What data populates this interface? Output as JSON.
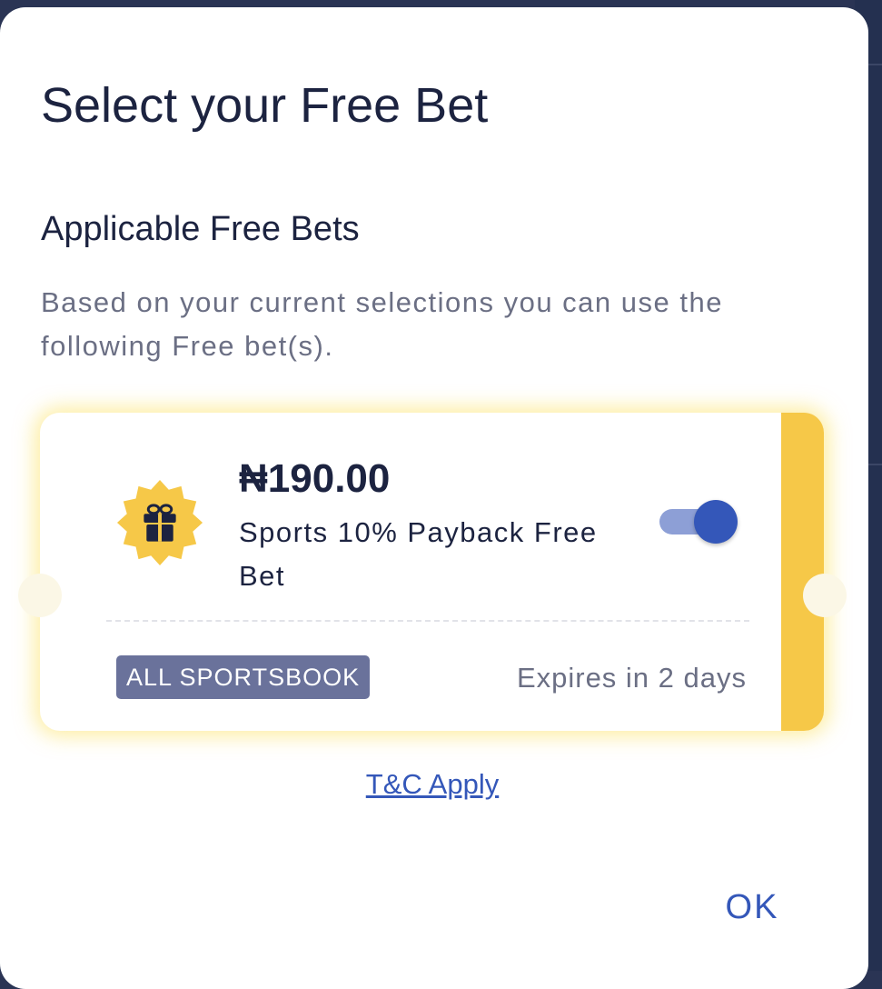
{
  "dialog": {
    "title": "Select your Free Bet",
    "section_title": "Applicable Free Bets",
    "description": "Based on your current selections you can use the following Free bet(s).",
    "ok_label": "OK",
    "tc_label": "T&C Apply"
  },
  "free_bets": [
    {
      "amount": "₦190.00",
      "name": "Sports 10% Payback Free Bet",
      "tag": "ALL SPORTSBOOK",
      "expiry": "Expires in 2 days",
      "selected": true,
      "icon": "gift-icon"
    }
  ],
  "colors": {
    "accent": "#3457b9",
    "toggle_track": "#8d9fd6",
    "badge": "#f6c848",
    "tag_bg": "#6a729b",
    "text_primary": "#1c2340",
    "text_secondary": "#6b6f84"
  }
}
